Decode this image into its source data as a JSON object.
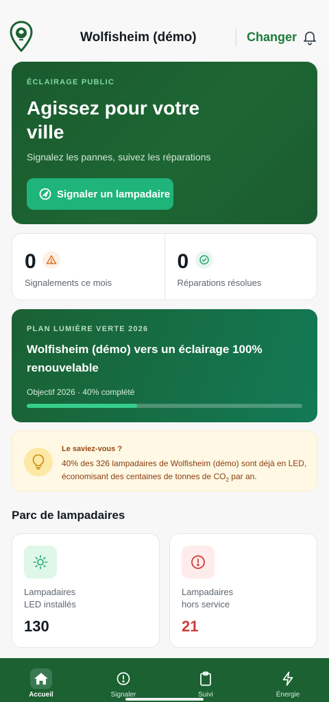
{
  "header": {
    "city": "Wolfisheim (démo)",
    "change_label": "Changer"
  },
  "hero": {
    "eyebrow": "ÉCLAIRAGE PUBLIC",
    "title": "Agissez pour votre ville",
    "subtitle": "Signalez les pannes, suivez les réparations",
    "button_label": "Signaler un lampadaire"
  },
  "stats": [
    {
      "value": "0",
      "label": "Signalements ce mois",
      "icon": "warning-icon",
      "color": "#e5742a"
    },
    {
      "value": "0",
      "label": "Réparations résolues",
      "icon": "check-circle-icon",
      "color": "#1fa56a"
    }
  ],
  "plan": {
    "eyebrow": "PLAN LUMIÈRE VERTE 2026",
    "title": "Wolfisheim (démo) vers un éclairage 100% renouvelable",
    "objective": "Objectif 2026 · 40% complété",
    "progress": 0.4
  },
  "tip": {
    "title": "Le saviez-vous ?",
    "text_before": "40% des 326 lampadaires de Wolfisheim (démo) sont déjà en LED, économisant des centaines de tonnes de CO",
    "text_sub": "2",
    "text_after": " par an."
  },
  "park": {
    "heading": "Parc de lampadaires",
    "cards": [
      {
        "line1": "Lampadaires",
        "line2": "LED installés",
        "value": "130",
        "icon": "sun-icon",
        "color": "#121a22"
      },
      {
        "line1": "Lampadaires",
        "line2": "hors service",
        "value": "21",
        "icon": "alert-circle-icon",
        "color": "#d23a3a"
      }
    ]
  },
  "nav": [
    {
      "label": "Accueil",
      "icon": "home-icon",
      "active": true
    },
    {
      "label": "Signaler",
      "icon": "alert-circle-icon",
      "active": false
    },
    {
      "label": "Suivi",
      "icon": "clipboard-icon",
      "active": false
    },
    {
      "label": "Énergie",
      "icon": "bolt-icon",
      "active": false
    }
  ],
  "colors": {
    "brand": "#1b6132",
    "accent": "#1fb47a",
    "link": "#1c7a3a"
  }
}
